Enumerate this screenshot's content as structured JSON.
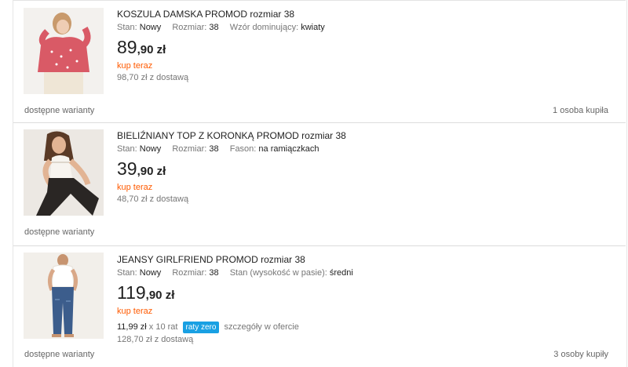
{
  "listings": [
    {
      "title": "KOSZULA DAMSKA PROMOD rozmiar 38",
      "params": [
        {
          "label": "Stan:",
          "value": "Nowy"
        },
        {
          "label": "Rozmiar:",
          "value": "38"
        },
        {
          "label": "Wzór dominujący:",
          "value": "kwiaty"
        }
      ],
      "price_int": "89",
      "price_dec": ",90 zł",
      "buy_now": "kup teraz",
      "shipping": "98,70 zł z dostawą",
      "variants": "dostępne warianty",
      "buyers": "1 osoba kupiła",
      "image_icon": "floral-blouse-photo"
    },
    {
      "title": "BIELIŹNIANY TOP Z KORONKĄ PROMOD rozmiar 38",
      "params": [
        {
          "label": "Stan:",
          "value": "Nowy"
        },
        {
          "label": "Rozmiar:",
          "value": "38"
        },
        {
          "label": "Fason:",
          "value": "na ramiączkach"
        }
      ],
      "price_int": "39",
      "price_dec": ",90 zł",
      "buy_now": "kup teraz",
      "shipping": "48,70 zł z dostawą",
      "variants": "dostępne warianty",
      "image_icon": "lace-top-photo"
    },
    {
      "title": "JEANSY GIRLFRIEND PROMOD rozmiar 38",
      "params": [
        {
          "label": "Stan:",
          "value": "Nowy"
        },
        {
          "label": "Rozmiar:",
          "value": "38"
        },
        {
          "label": "Stan (wysokość w pasie):",
          "value": "średni"
        }
      ],
      "price_int": "119",
      "price_dec": ",90 zł",
      "buy_now": "kup teraz",
      "installment_amount": "11,99 zł",
      "installment_count": "x 10 rat",
      "installment_badge": "raty zero",
      "installment_details": "szczegóły w ofercie",
      "shipping": "128,70 zł z dostawą",
      "variants": "dostępne warianty",
      "buyers": "3 osoby kupiły",
      "image_icon": "jeans-photo"
    }
  ],
  "colors": {
    "buy_now": "#ff5a00",
    "badge": "#19a0e3",
    "muted": "#767676"
  }
}
